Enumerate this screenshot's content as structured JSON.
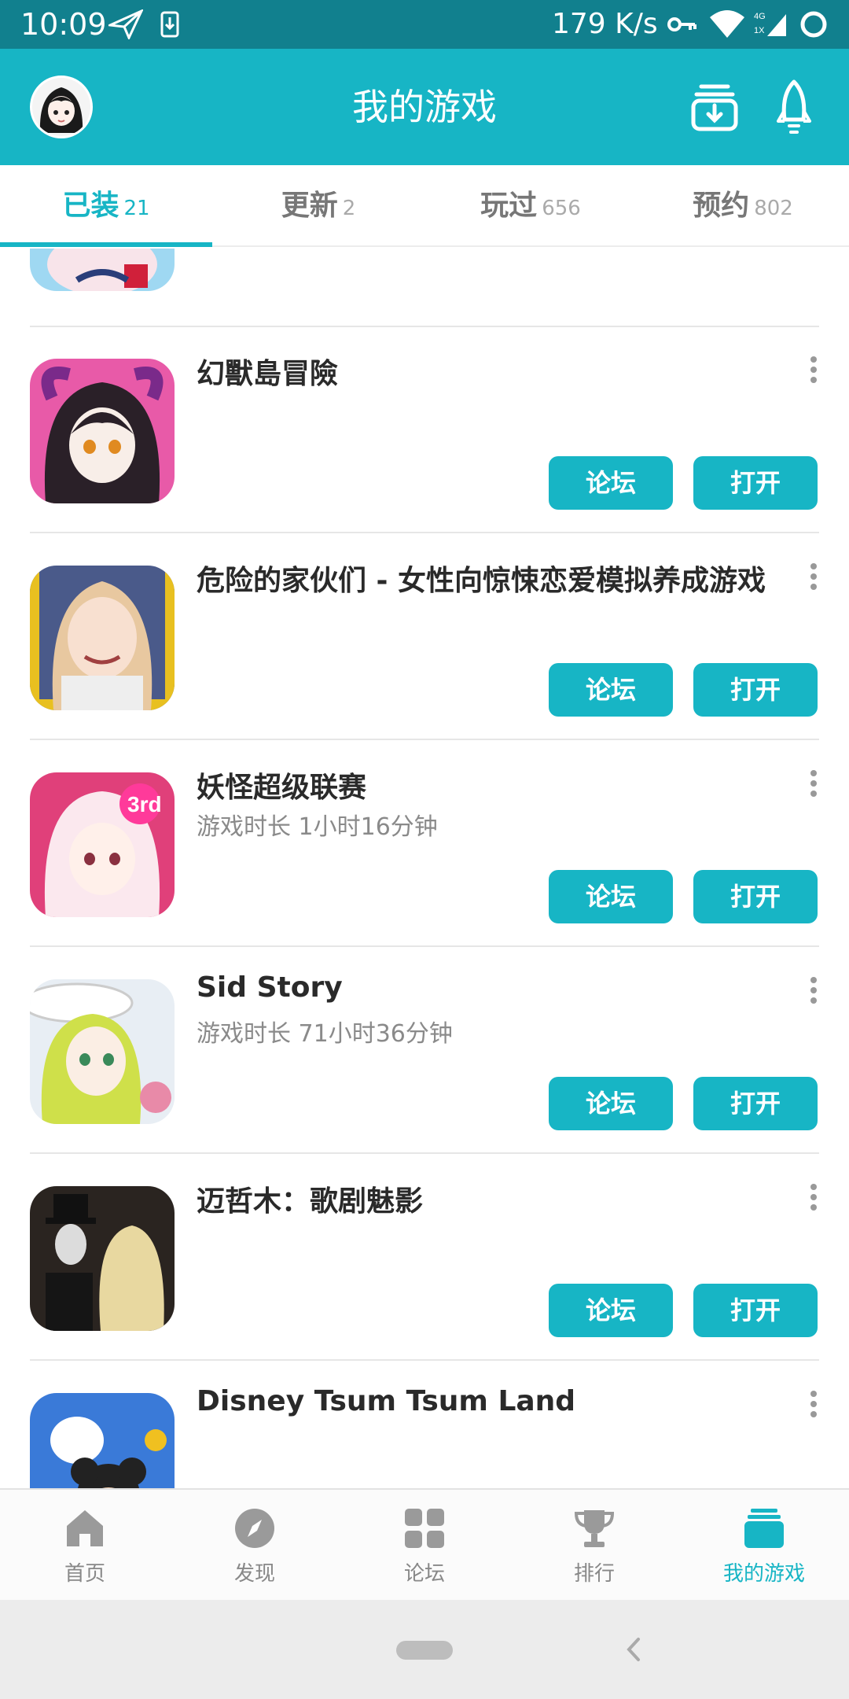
{
  "status_bar": {
    "time": "10:09",
    "net_speed": "179 K/s",
    "network_badge_top": "4G",
    "network_badge_bottom": "1X"
  },
  "header": {
    "title": "我的游戏"
  },
  "tabs": [
    {
      "label": "已装",
      "count": "21",
      "active": true
    },
    {
      "label": "更新",
      "count": "2",
      "active": false
    },
    {
      "label": "玩过",
      "count": "656",
      "active": false
    },
    {
      "label": "预约",
      "count": "802",
      "active": false
    }
  ],
  "game_actions": {
    "forum_label": "论坛",
    "open_label": "打开"
  },
  "games": [
    {
      "title": "",
      "subtitle": ""
    },
    {
      "title": "幻獸島冒險",
      "subtitle": ""
    },
    {
      "title": "危险的家伙们 - 女性向惊悚恋爱模拟养成游戏",
      "subtitle": ""
    },
    {
      "title": "妖怪超级联赛",
      "subtitle": "游戏时长 1小时16分钟"
    },
    {
      "title": "Sid Story",
      "subtitle": "游戏时长 71小时36分钟"
    },
    {
      "title": "迈哲木：歌剧魅影",
      "subtitle": ""
    },
    {
      "title": "Disney Tsum Tsum Land",
      "subtitle": ""
    }
  ],
  "bottom_nav": [
    {
      "label": "首页",
      "icon": "home-icon",
      "active": false
    },
    {
      "label": "发现",
      "icon": "compass-icon",
      "active": false
    },
    {
      "label": "论坛",
      "icon": "grid-icon",
      "active": false
    },
    {
      "label": "排行",
      "icon": "trophy-icon",
      "active": false
    },
    {
      "label": "我的游戏",
      "icon": "stack-icon",
      "active": true
    }
  ],
  "colors": {
    "accent": "#17b5c5",
    "status_bar": "#11808e"
  }
}
